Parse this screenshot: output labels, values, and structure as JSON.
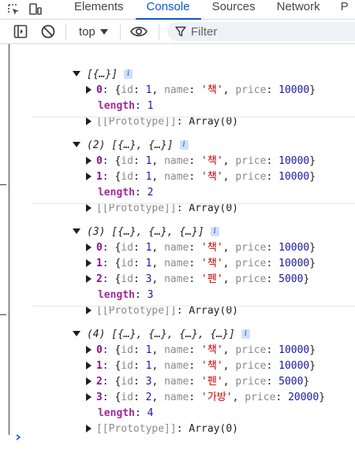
{
  "tabs": [
    "Elements",
    "Console",
    "Sources",
    "Network",
    "P"
  ],
  "toolbar": {
    "context": "top",
    "filter_placeholder": "Filter"
  },
  "entries": [
    {
      "header_count": "",
      "header_items": "[{…}]",
      "rows": [
        {
          "index": "0",
          "id": "1",
          "name": "'책'",
          "price": "10000"
        }
      ],
      "length_key": "length",
      "length_value": "1",
      "prototype_key": "[[Prototype]]",
      "prototype_value": "Array(0)"
    },
    {
      "header_count": "(2)",
      "header_items": "[{…}, {…}]",
      "rows": [
        {
          "index": "0",
          "id": "1",
          "name": "'책'",
          "price": "10000"
        },
        {
          "index": "1",
          "id": "1",
          "name": "'책'",
          "price": "10000"
        }
      ],
      "length_key": "length",
      "length_value": "2",
      "prototype_key": "[[Prototype]]",
      "prototype_value": "Array(0)"
    },
    {
      "header_count": "(3)",
      "header_items": "[{…}, {…}, {…}]",
      "rows": [
        {
          "index": "0",
          "id": "1",
          "name": "'책'",
          "price": "10000"
        },
        {
          "index": "1",
          "id": "1",
          "name": "'책'",
          "price": "10000"
        },
        {
          "index": "2",
          "id": "3",
          "name": "'펜'",
          "price": "5000"
        }
      ],
      "length_key": "length",
      "length_value": "3",
      "prototype_key": "[[Prototype]]",
      "prototype_value": "Array(0)"
    },
    {
      "header_count": "(4)",
      "header_items": "[{…}, {…}, {…}, {…}]",
      "rows": [
        {
          "index": "0",
          "id": "1",
          "name": "'책'",
          "price": "10000"
        },
        {
          "index": "1",
          "id": "1",
          "name": "'책'",
          "price": "10000"
        },
        {
          "index": "2",
          "id": "3",
          "name": "'펜'",
          "price": "5000"
        },
        {
          "index": "3",
          "id": "2",
          "name": "'가방'",
          "price": "20000"
        }
      ],
      "length_key": "length",
      "length_value": "4",
      "prototype_key": "[[Prototype]]",
      "prototype_value": "Array(0)"
    }
  ],
  "labels": {
    "id": "id",
    "name": "name",
    "price": "price"
  },
  "icons": [
    "inspect-icon",
    "device-toolbar-icon",
    "sidebar-toggle-icon",
    "clear-console-icon",
    "dropdown-arrow-icon",
    "eye-icon",
    "filter-icon",
    "info-icon"
  ],
  "colors": {
    "accent": "#0b57d0",
    "index": "#881391",
    "number": "#1a1aa6",
    "string": "#c80000"
  }
}
